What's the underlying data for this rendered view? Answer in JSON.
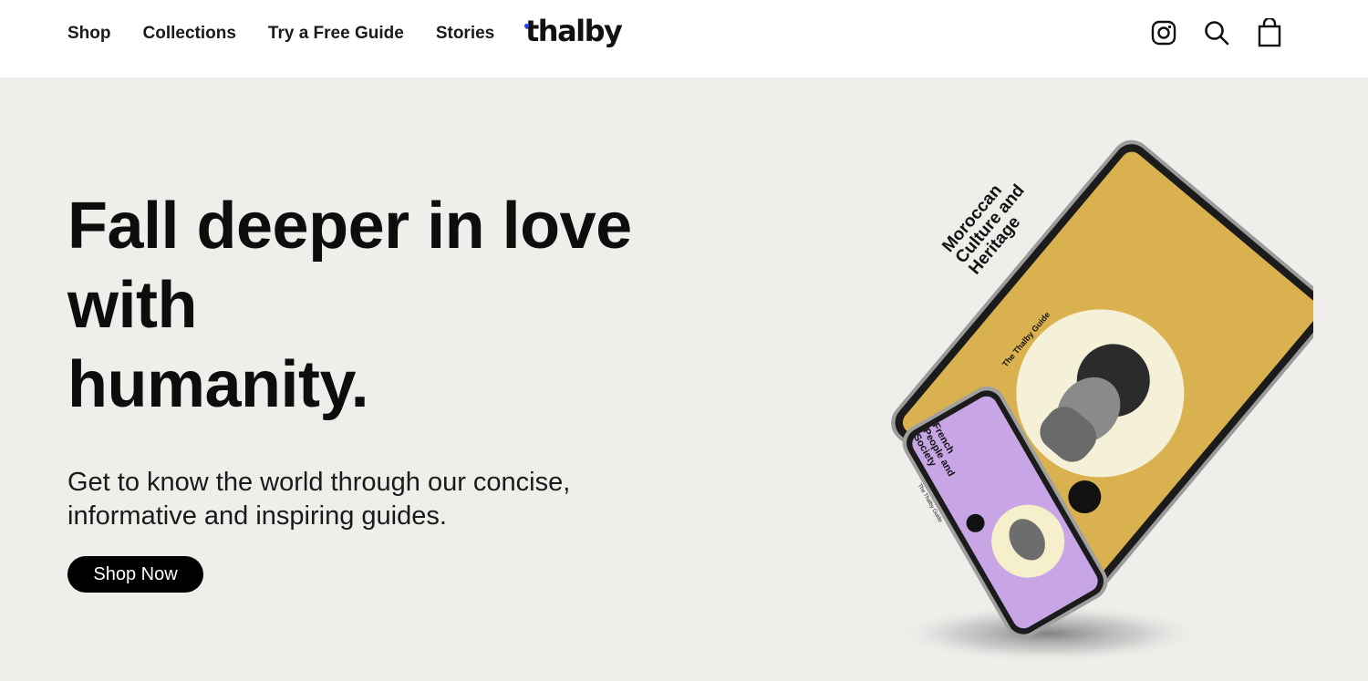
{
  "nav": {
    "items": [
      {
        "label": "Shop"
      },
      {
        "label": "Collections"
      },
      {
        "label": "Try a Free Guide"
      },
      {
        "label": "Stories"
      }
    ],
    "logo": "thalby"
  },
  "icons": [
    "instagram-icon",
    "search-icon",
    "shopping-bag-icon"
  ],
  "hero": {
    "headline_line1": "Fall deeper in love",
    "headline_line2": "with",
    "headline_line3": "humanity.",
    "subheadline": "Get to know the world through our concise, informative and inspiring guides.",
    "cta_label": "Shop Now"
  },
  "devices": {
    "tablet": {
      "title": "Moroccan Culture and Heritage",
      "subtitle": "The Thalby Guide",
      "color": "#d9b24f"
    },
    "phone": {
      "title": "French People and Society",
      "subtitle": "The Thalby Guide",
      "color": "#c8a6e6"
    }
  },
  "colors": {
    "background": "#efeeeb",
    "header": "#ffffff",
    "accent_dot": "#1f3cff",
    "button": "#000000"
  }
}
